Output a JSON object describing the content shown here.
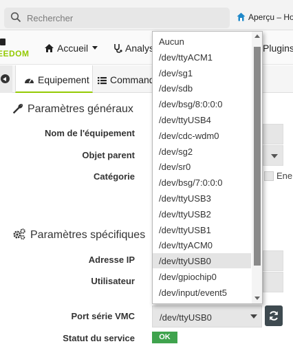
{
  "browser": {
    "search_placeholder": "Rechercher",
    "preview_label": "Aperçu – Hom"
  },
  "app": {
    "brand": "EEDOM",
    "nav": {
      "home": "Accueil",
      "analysis": "Analys",
      "plugins": "Plugins"
    }
  },
  "tabs": {
    "equipment": "Equipement",
    "commands": "Commande"
  },
  "general": {
    "title": "Paramètres généraux",
    "name_label": "Nom de l'équipement",
    "parent_label": "Objet parent",
    "category_label": "Catégorie",
    "category_option": "Ener"
  },
  "specific": {
    "title": "Paramètres spécifiques",
    "ip_label": "Adresse IP",
    "user_label": "Utilisateur",
    "port_label": "Port série VMC",
    "port_value": "/dev/ttyUSB0",
    "status_label": "Statut du service",
    "status_value": "OK"
  },
  "dropdown": {
    "selected_index": 14,
    "options": [
      "Aucun",
      "/dev/ttyACM1",
      "/dev/sg1",
      "/dev/sdb",
      "/dev/bsg/8:0:0:0",
      "/dev/ttyUSB4",
      "/dev/cdc-wdm0",
      "/dev/sg2",
      "/dev/sr0",
      "/dev/bsg/7:0:0:0",
      "/dev/ttyUSB3",
      "/dev/ttyUSB2",
      "/dev/ttyUSB1",
      "/dev/ttyACM0",
      "/dev/ttyUSB0",
      "/dev/gpiochip0",
      "/dev/input/event5"
    ]
  },
  "colors": {
    "accent": "#94ca02",
    "ok": "#3fa34d",
    "refresh_button": "#3e4a50"
  },
  "icons": {
    "search": "search-icon",
    "preview": "jeedom-logo-icon",
    "home": "home-icon",
    "analysis": "stethoscope-icon",
    "plugins": "puzzle-icon",
    "back": "arrow-circle-left-icon",
    "equipment": "tachometer-icon",
    "commands": "list-icon",
    "general": "wrench-icon",
    "specific": "cogs-icon",
    "refresh": "refresh-icon"
  }
}
